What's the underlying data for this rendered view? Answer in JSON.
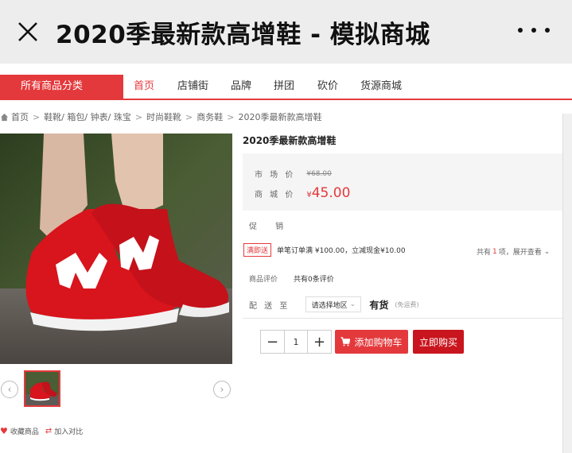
{
  "window": {
    "title": "2020季最新款高增鞋 - 模拟商城",
    "close_icon": "close-icon",
    "more_icon": "more-icon"
  },
  "nav": {
    "category": "所有商品分类",
    "items": [
      "首页",
      "店铺街",
      "品牌",
      "拼团",
      "砍价",
      "货源商城"
    ]
  },
  "breadcrumb": [
    "首页",
    "鞋靴/ 箱包/ 钟表/ 珠宝",
    "时尚鞋靴",
    "商务鞋",
    "2020季最新款高增鞋"
  ],
  "product": {
    "name": "2020季最新款高增鞋",
    "market_label": "市 场 价",
    "market_price": "¥68.00",
    "mall_label": "商 城 价",
    "currency": "¥",
    "mall_price": "45.00",
    "promo_label": "促 销",
    "promo_tag": "满即送",
    "promo_text": "单笔订单满 ¥100.00，立减现金¥10.00",
    "promo_count_prefix": "共有",
    "promo_count": "1",
    "promo_count_suffix": "项，展开查看",
    "review_label": "商品评价",
    "review_text": "共有0条评价",
    "ship_label": "配 送 至",
    "region_placeholder": "请选择地区",
    "stock": "有货",
    "shipping_note": "(免运费)",
    "quantity": "1"
  },
  "buttons": {
    "minus": "−",
    "plus": "+",
    "add_to_cart": "添加购物车",
    "buy_now": "立即购买"
  },
  "gallery": {
    "prev": "‹",
    "next": "›"
  },
  "small_actions": {
    "favorite": "收藏商品",
    "compare": "加入对比"
  },
  "colors": {
    "accent": "#e4393c",
    "buy": "#c9151e",
    "shoe_red": "#d8141c"
  }
}
